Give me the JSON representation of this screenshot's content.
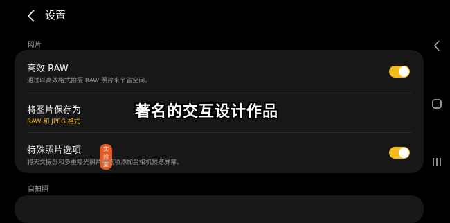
{
  "header": {
    "title": "设置"
  },
  "sections": {
    "photos_label": "照片",
    "selfie_label": "自拍照"
  },
  "rows": {
    "raw": {
      "title": "高效 RAW",
      "subtitle": "通过以高效格式拍摄 RAW 照片来节省空间。",
      "toggle_on": true
    },
    "save_as": {
      "title": "将图片保存为",
      "value": "RAW 和 JPEG 格式"
    },
    "special": {
      "title": "特殊照片选项",
      "badge": "实验室",
      "subtitle": "将天文摄影和多重曝光照片的选项添加至相机预览屏幕。",
      "toggle_on": true
    }
  },
  "overlay": {
    "text": "著名的交互设计作品"
  },
  "colors": {
    "accent": "#f2bd1c",
    "badge": "#e55a22",
    "card": "#171717",
    "background": "#000000"
  },
  "icons": {
    "back": "chevron-left-icon",
    "nav_back": "nav-back-icon",
    "nav_home": "nav-home-icon",
    "nav_recents": "nav-recents-icon"
  }
}
